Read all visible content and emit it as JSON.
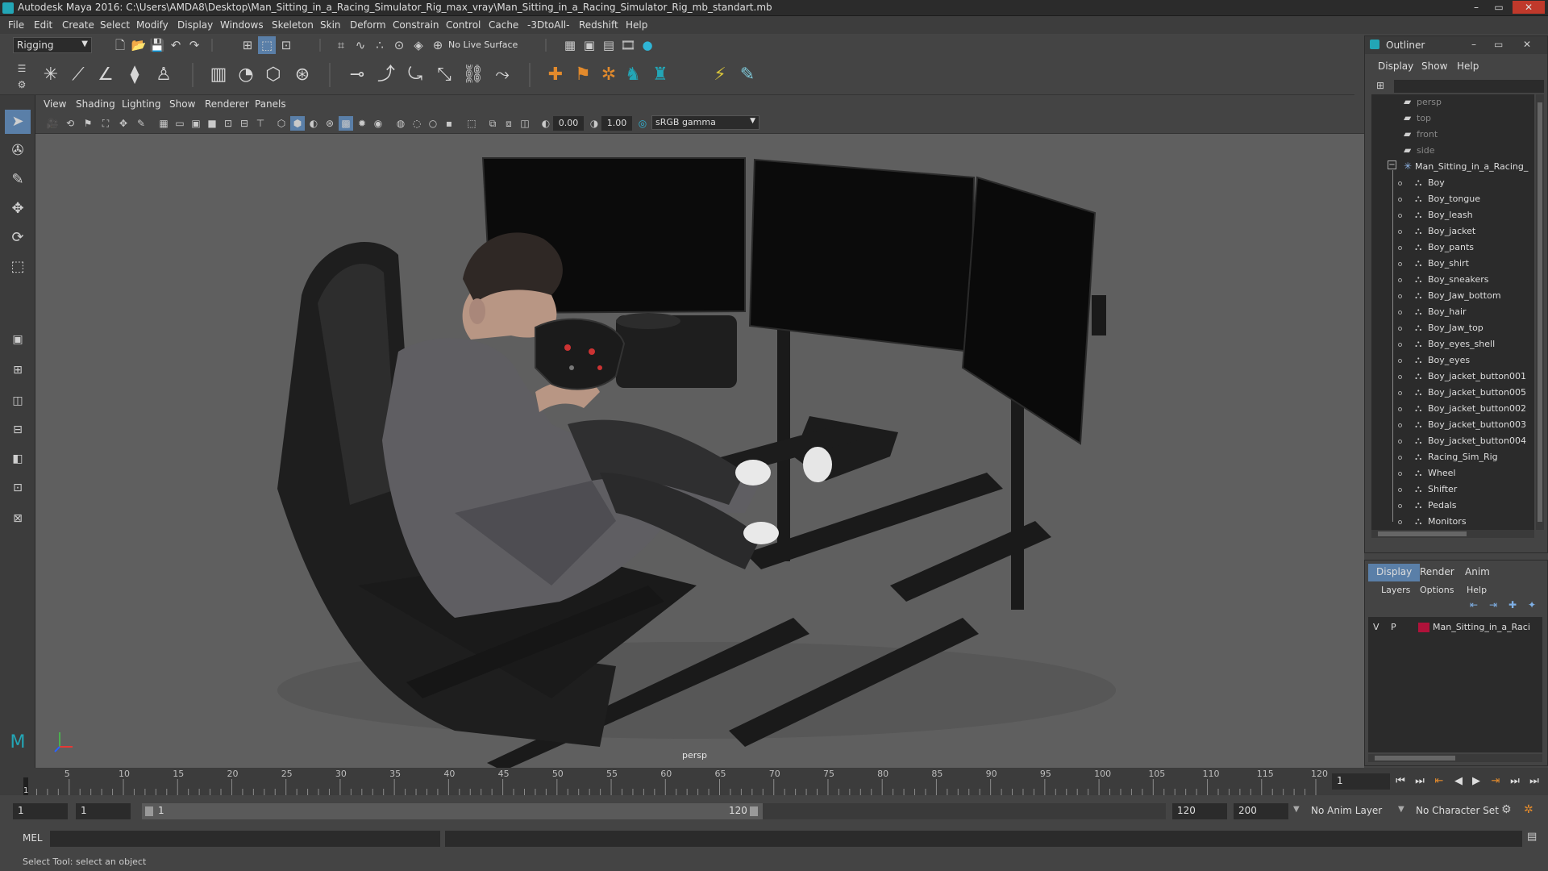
{
  "window": {
    "title": "Autodesk Maya 2016: C:\\Users\\AMDA8\\Desktop\\Man_Sitting_in_a_Racing_Simulator_Rig_max_vray\\Man_Sitting_in_a_Racing_Simulator_Rig_mb_standart.mb",
    "controls": [
      "–",
      "▭",
      "✕"
    ]
  },
  "menubar": [
    "File",
    "Edit",
    "Create",
    "Select",
    "Modify",
    "Display",
    "Windows",
    "Skeleton",
    "Skin",
    "Deform",
    "Constrain",
    "Control",
    "Cache",
    "-3DtoAll-",
    "Redshift",
    "Help"
  ],
  "status_line": {
    "menu_set": "Rigging",
    "live_surface": "No Live Surface"
  },
  "viewport": {
    "menu": [
      "View",
      "Shading",
      "Lighting",
      "Show",
      "Renderer",
      "Panels"
    ],
    "exposure": "0.00",
    "gamma": "1.00",
    "color_space": "sRGB gamma",
    "camera_label": "persp"
  },
  "outliner": {
    "title": "Outliner",
    "menu": [
      "Display",
      "Show",
      "Help"
    ],
    "cameras": [
      "persp",
      "top",
      "front",
      "side"
    ],
    "root": "Man_Sitting_in_a_Racing_",
    "children": [
      "Boy",
      "Boy_tongue",
      "Boy_leash",
      "Boy_jacket",
      "Boy_pants",
      "Boy_shirt",
      "Boy_sneakers",
      "Boy_Jaw_bottom",
      "Boy_hair",
      "Boy_Jaw_top",
      "Boy_eyes_shell",
      "Boy_eyes",
      "Boy_jacket_button001",
      "Boy_jacket_button005",
      "Boy_jacket_button002",
      "Boy_jacket_button003",
      "Boy_jacket_button004",
      "Racing_Sim_Rig",
      "Wheel",
      "Shifter",
      "Pedals",
      "Monitors"
    ]
  },
  "layer_editor": {
    "tabs": [
      "Display",
      "Render",
      "Anim"
    ],
    "menu": [
      "Layers",
      "Options",
      "Help"
    ],
    "layer": {
      "v": "V",
      "p": "P",
      "name": "Man_Sitting_in_a_Raci",
      "color": "#b0123a"
    }
  },
  "timeline": {
    "ticks": [
      "5",
      "10",
      "15",
      "20",
      "25",
      "30",
      "35",
      "40",
      "45",
      "50",
      "55",
      "60",
      "65",
      "70",
      "75",
      "80",
      "85",
      "90",
      "95",
      "100",
      "105",
      "110",
      "115",
      "120"
    ],
    "start_marker": "1",
    "current_frame": "1"
  },
  "range": {
    "start": "1",
    "playback_start": "1",
    "slider_start": "1",
    "slider_end": "120",
    "playback_end": "120",
    "end": "200",
    "anim_layer": "No Anim Layer",
    "char_set": "No Character Set"
  },
  "command_line": {
    "label": "MEL"
  },
  "help_line": {
    "text": "Select Tool: select an object"
  }
}
